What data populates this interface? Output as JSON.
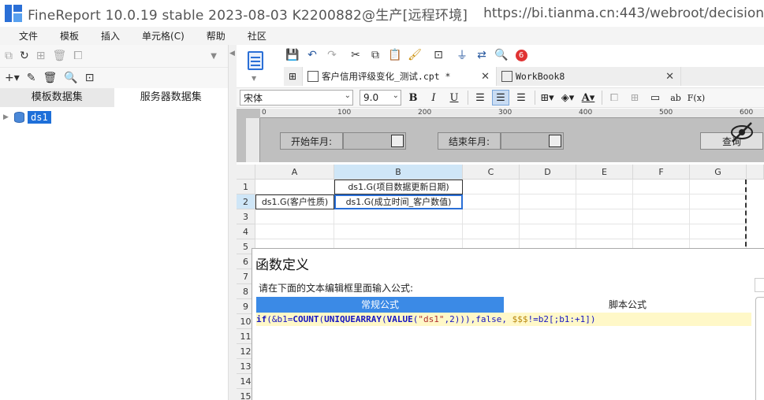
{
  "window": {
    "title": "FineReport 10.0.19 stable 2023-08-03 K2200882@生产[远程环境]",
    "url": "https://bi.tianma.cn:443/webroot/decision"
  },
  "menu": [
    "文件",
    "模板",
    "插入",
    "单元格(C)",
    "帮助",
    "社区"
  ],
  "left_panel": {
    "tabs": [
      "模板数据集",
      "服务器数据集"
    ],
    "tree": [
      {
        "label": "ds1"
      }
    ]
  },
  "toolbar": {
    "badge_count": "6"
  },
  "doc_tabs": [
    {
      "label": "客户信用评级变化_测试.cpt *",
      "active": true
    },
    {
      "label": "WorkBook8",
      "active": false
    }
  ],
  "format": {
    "font": "宋体",
    "size": "9.0",
    "bold": "B",
    "italic": "I",
    "underline": "U",
    "ab_label": "ab",
    "fx_label": "F(x)"
  },
  "param_panel": {
    "ruler_ticks": [
      "0",
      "100",
      "200",
      "300",
      "400",
      "500",
      "600"
    ],
    "start_label": "开始年月:",
    "end_label": "结束年月:",
    "query_label": "查询"
  },
  "grid": {
    "columns": [
      "A",
      "B",
      "C",
      "D",
      "E",
      "F",
      "G"
    ],
    "rows": [
      "1",
      "2",
      "3",
      "4",
      "5",
      "6",
      "7",
      "8",
      "9",
      "10",
      "11",
      "12",
      "13",
      "14",
      "15"
    ],
    "cells": {
      "B1": "ds1.G(项目数据更新日期)",
      "A2": "ds1.G(客户性质)",
      "B2": "ds1.G(成立时间_客户数值)"
    }
  },
  "dialog": {
    "title": "函数定义",
    "prompt": "请在下面的文本编辑框里面输入公式:",
    "tabs": [
      "常规公式",
      "脚本公式"
    ],
    "formula": "if(&b1=COUNT(UNIQUEARRAY(VALUE(\"ds1\",2))),false, $$$!=b2[;b1:+1])"
  }
}
